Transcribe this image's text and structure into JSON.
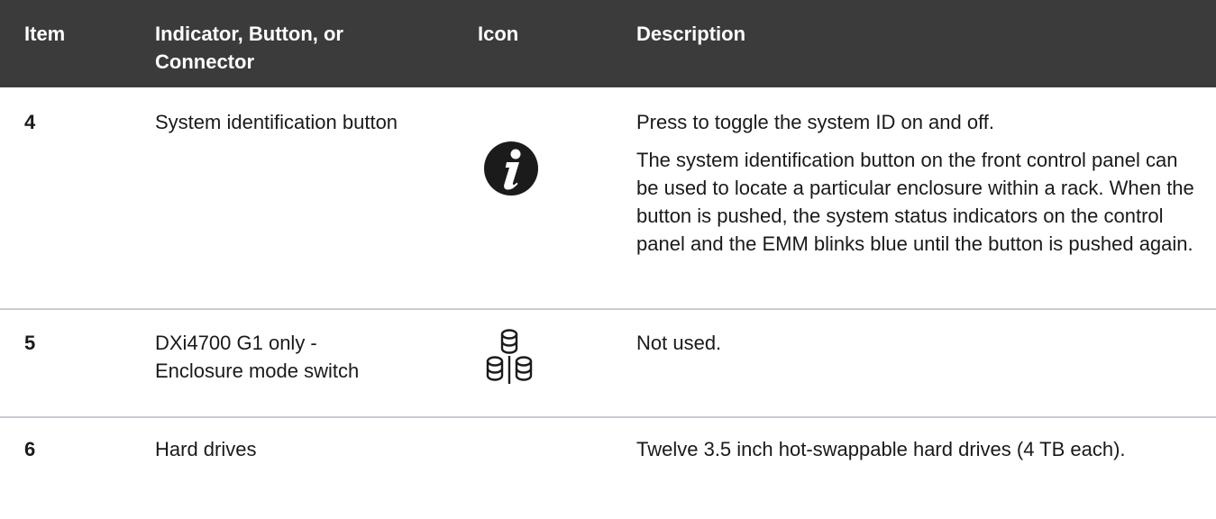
{
  "table": {
    "headers": {
      "item": "Item",
      "indicator": "Indicator, Button, or Connector",
      "icon": "Icon",
      "description": "Description"
    },
    "rows": [
      {
        "item": "4",
        "indicator": "System identification button",
        "icon": "info-icon",
        "description": [
          "Press to toggle the system ID on and off.",
          "The system identification button on the front control panel can be used to locate a particular enclosure within a rack. When the button is pushed, the system status indicators on the control panel and the EMM blinks blue until the button is pushed again."
        ]
      },
      {
        "item": "5",
        "indicator": "DXi4700 G1 only - Enclosure mode switch",
        "icon": "enclosure-mode-switch-icon",
        "description": [
          "Not used."
        ]
      },
      {
        "item": "6",
        "indicator": "Hard drives",
        "icon": "",
        "description": [
          "Twelve 3.5 inch hot-swappable hard drives (4 TB each)."
        ]
      }
    ]
  },
  "colors": {
    "header_bg": "#3b3b3b",
    "header_text": "#ffffff",
    "rule": "#c9cdd3",
    "body_text": "#1a1a1a"
  }
}
